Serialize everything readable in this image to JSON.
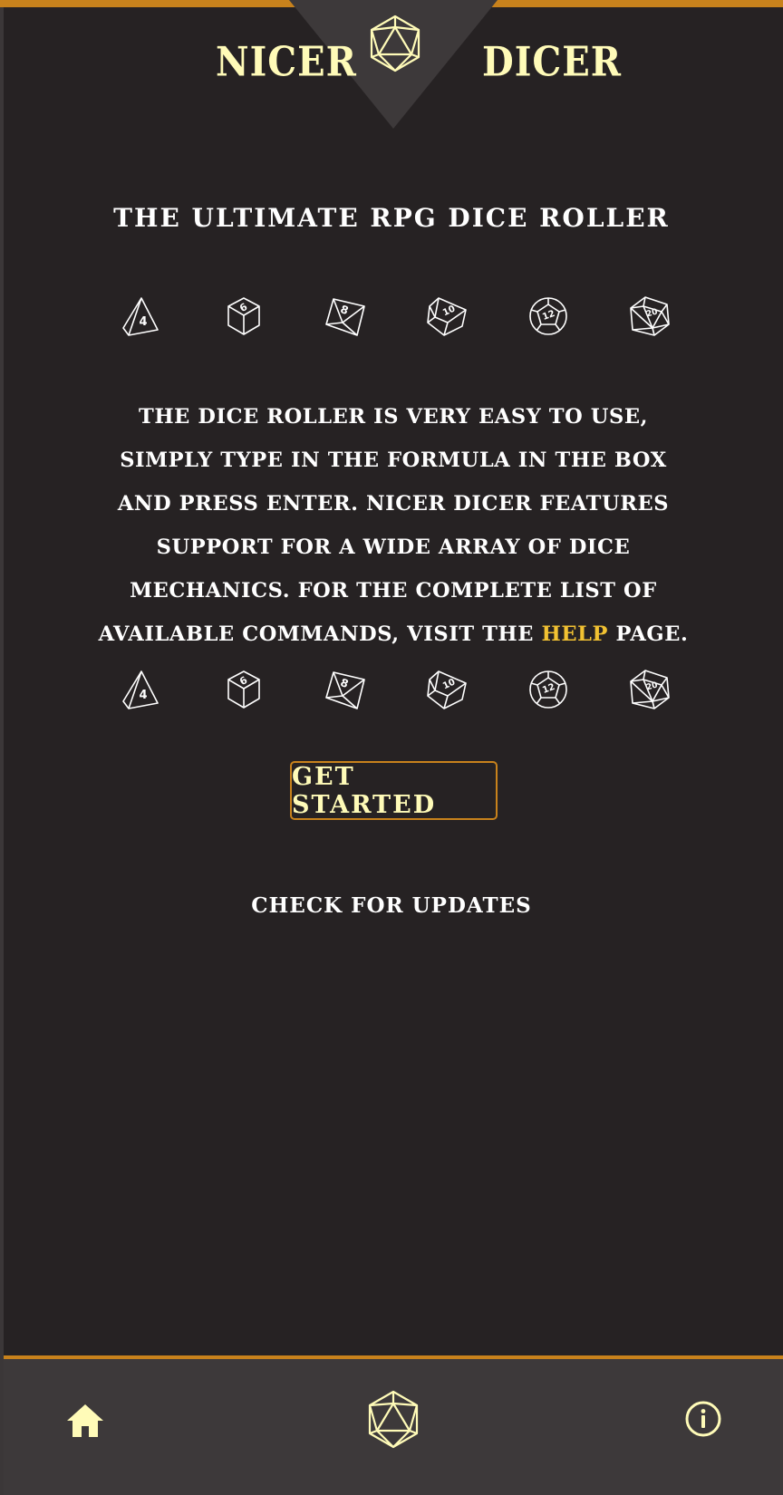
{
  "app": {
    "name_left": "NICER",
    "name_right": "DICER"
  },
  "colors": {
    "background": "#262223",
    "accent": "#c8821c",
    "brand_text": "#fffbb8",
    "link": "#f2c232",
    "nav_background": "#3d393a"
  },
  "main": {
    "tagline": "THE ULTIMATE RPG DICE ROLLER",
    "description_before_link": "THE DICE ROLLER IS VERY EASY TO USE, SIMPLY TYPE IN THE FORMULA IN THE BOX AND PRESS ENTER. NICER DICER FEATURES SUPPORT FOR A WIDE ARRAY OF DICE MECHANICS. FOR THE COMPLETE LIST OF AVAILABLE COMMANDS, VISIT THE ",
    "help_link": "HELP",
    "description_after_link": " PAGE.",
    "get_started": "GET STARTED",
    "check_updates": "CHECK FOR UPDATES"
  },
  "dice": [
    {
      "icon": "d4-icon",
      "label": "4"
    },
    {
      "icon": "d6-icon",
      "label": "6"
    },
    {
      "icon": "d8-icon",
      "label": "8"
    },
    {
      "icon": "d10-icon",
      "label": "10"
    },
    {
      "icon": "d12-icon",
      "label": "12"
    },
    {
      "icon": "d20-icon",
      "label": "20"
    }
  ],
  "bottom_nav": {
    "items": [
      {
        "icon": "home-icon"
      },
      {
        "icon": "d20-icon"
      },
      {
        "icon": "info-icon"
      }
    ]
  }
}
